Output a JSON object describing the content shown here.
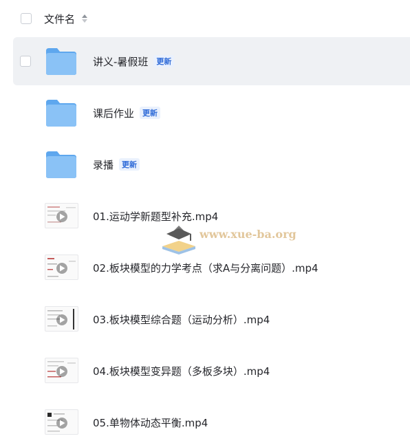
{
  "header": {
    "column_label": "文件名"
  },
  "files": [
    {
      "name": "讲义-暑假班",
      "badge": "更新",
      "kind": "folder"
    },
    {
      "name": "课后作业",
      "badge": "更新",
      "kind": "folder"
    },
    {
      "name": "录播",
      "badge": "更新",
      "kind": "folder"
    },
    {
      "name": "01.运动学新题型补充.mp4",
      "kind": "video"
    },
    {
      "name": "02.板块模型的力学考点（求A与分离问题）.mp4",
      "kind": "video"
    },
    {
      "name": "03.板块模型综合题（运动分析）.mp4",
      "kind": "video"
    },
    {
      "name": "04.板块模型变异题（多板多块）.mp4",
      "kind": "video"
    },
    {
      "name": "05.单物体动态平衡.mp4",
      "kind": "video"
    }
  ],
  "watermark": {
    "text": "www.xue-ba.org"
  }
}
